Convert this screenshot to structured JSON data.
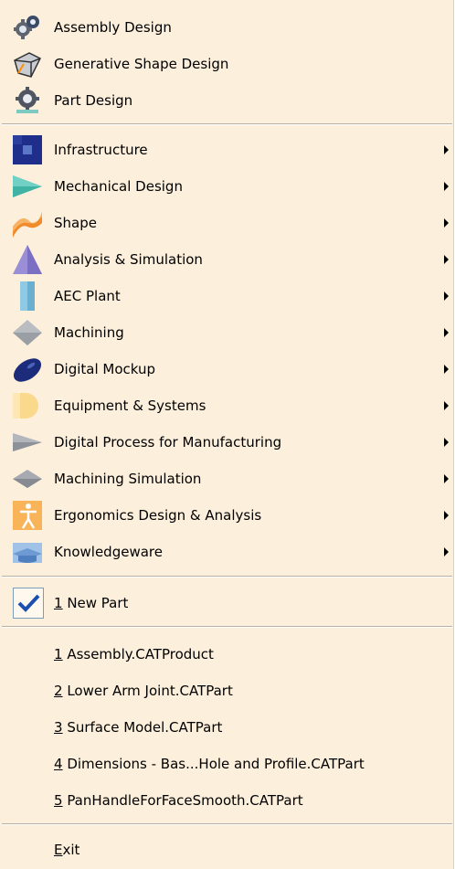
{
  "workbenches": [
    {
      "label": "Assembly Design",
      "icon": "assembly-gears-icon"
    },
    {
      "label": "Generative Shape Design",
      "icon": "shape-design-icon"
    },
    {
      "label": "Part Design",
      "icon": "part-gear-icon"
    }
  ],
  "categories": [
    {
      "label": "Infrastructure",
      "icon": "infrastructure-icon"
    },
    {
      "label": "Mechanical Design",
      "icon": "mechanical-design-icon"
    },
    {
      "label": "Shape",
      "icon": "shape-icon"
    },
    {
      "label": "Analysis & Simulation",
      "icon": "analysis-simulation-icon"
    },
    {
      "label": "AEC Plant",
      "icon": "aec-plant-icon"
    },
    {
      "label": "Machining",
      "icon": "machining-icon"
    },
    {
      "label": "Digital Mockup",
      "icon": "digital-mockup-icon"
    },
    {
      "label": "Equipment & Systems",
      "icon": "equipment-systems-icon"
    },
    {
      "label": "Digital Process for Manufacturing",
      "icon": "digital-process-icon"
    },
    {
      "label": "Machining Simulation",
      "icon": "machining-simulation-icon"
    },
    {
      "label": "Ergonomics Design & Analysis",
      "icon": "ergonomics-icon"
    },
    {
      "label": "Knowledgeware",
      "icon": "knowledgeware-icon"
    }
  ],
  "windows": [
    {
      "mnemonic": "1",
      "label": " New Part",
      "checked": true
    }
  ],
  "recent_files": [
    {
      "mnemonic": "1",
      "label": " Assembly.CATProduct"
    },
    {
      "mnemonic": "2",
      "label": " Lower Arm Joint.CATPart"
    },
    {
      "mnemonic": "3",
      "label": " Surface Model.CATPart"
    },
    {
      "mnemonic": "4",
      "label": " Dimensions - Bas...Hole and Profile.CATPart"
    },
    {
      "mnemonic": "5",
      "label": " PanHandleForFaceSmooth.CATPart"
    }
  ],
  "exit": {
    "mnemonic": "E",
    "rest": "xit"
  },
  "colors": {
    "menu_background": "#fcefdc",
    "separator": "#b8b0a3",
    "check": "#1a4fb0"
  }
}
